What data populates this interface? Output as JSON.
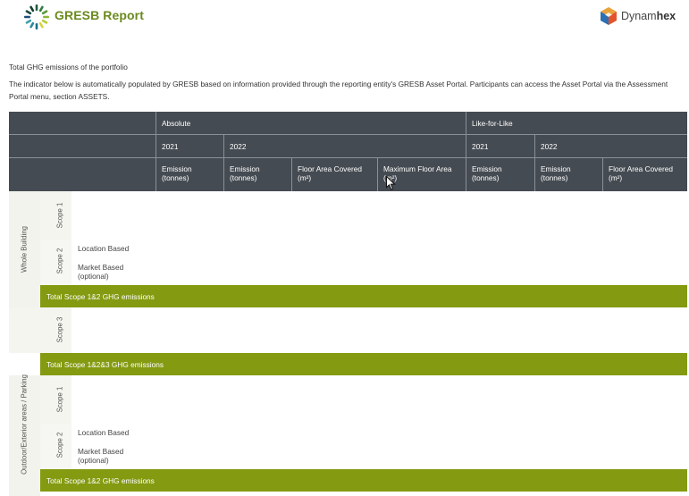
{
  "brand": {
    "gresb_title": "GRESB Report",
    "dynamhex_name_regular": "Dynam",
    "dynamhex_name_bold": "hex"
  },
  "intro": {
    "title": "Total GHG emissions of the portfolio",
    "text": "The indicator below is automatically populated by GRESB based on information provided through the reporting entity's GRESB Asset Portal. Participants can access the Asset Portal via the Assessment Portal menu, section ASSETS."
  },
  "table_header": {
    "groups": {
      "absolute": "Absolute",
      "like_for_like": "Like-for-Like"
    },
    "years": {
      "abs_2021": "2021",
      "abs_2022": "2022",
      "lfl_2021": "2021",
      "lfl_2022": "2022"
    },
    "columns": {
      "abs_2021_emission": [
        "Emission",
        "(tonnes)"
      ],
      "abs_2022_emission": [
        "Emission",
        "(tonnes)"
      ],
      "abs_2022_floor_area": [
        "Floor Area Covered",
        "(m²)"
      ],
      "abs_2022_max_floor_area": [
        "Maximum Floor Area",
        "(m²)"
      ],
      "lfl_2021_emission": [
        "Emission",
        "(tonnes)"
      ],
      "lfl_2022_emission": [
        "Emission",
        "(tonnes)"
      ],
      "lfl_2022_floor_area": [
        "Floor Area Covered",
        "(m²)"
      ]
    }
  },
  "whole_building": {
    "label": "Whole Building",
    "scope1": "Scope 1",
    "scope2": "Scope 2",
    "location_based": "Location Based",
    "market_based": [
      "Market Based",
      "(optional)"
    ],
    "total_scope12": "Total Scope 1&2 GHG emissions",
    "scope3": "Scope 3",
    "total_scope123": "Total Scope 1&2&3 GHG emissions"
  },
  "outdoor": {
    "label": "Outdoor/Exterior areas / Parking",
    "scope1": "Scope 1",
    "scope2": "Scope 2",
    "location_based": "Location Based",
    "market_based": [
      "Market Based",
      "(optional)"
    ],
    "total_scope12": "Total Scope 1&2 GHG emissions"
  },
  "colors": {
    "brand_green": "#6b8a1e",
    "total_bar": "#849a10",
    "header_bg": "#454b52"
  }
}
